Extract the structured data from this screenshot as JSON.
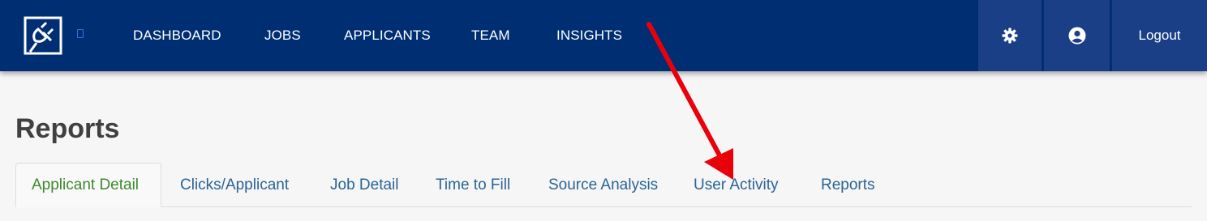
{
  "nav": {
    "items": [
      "DASHBOARD",
      "JOBS",
      "APPLICANTS",
      "TEAM",
      "INSIGHTS"
    ],
    "settings_icon": "gear-icon",
    "account_icon": "user-circle-icon",
    "logout_label": "Logout"
  },
  "page": {
    "title": "Reports"
  },
  "tabs": [
    {
      "label": "Applicant Detail",
      "active": true
    },
    {
      "label": "Clicks/Applicant",
      "active": false
    },
    {
      "label": "Job Detail",
      "active": false
    },
    {
      "label": "Time to Fill",
      "active": false
    },
    {
      "label": "Source Analysis",
      "active": false
    },
    {
      "label": "User Activity",
      "active": false
    },
    {
      "label": "Reports",
      "active": false
    }
  ],
  "colors": {
    "topbar": "#002e73",
    "topbar_button": "#1b3f86",
    "active_tab_text": "#3c8a2e",
    "tab_text": "#2a6496",
    "annotation_arrow": "#e8000b"
  }
}
